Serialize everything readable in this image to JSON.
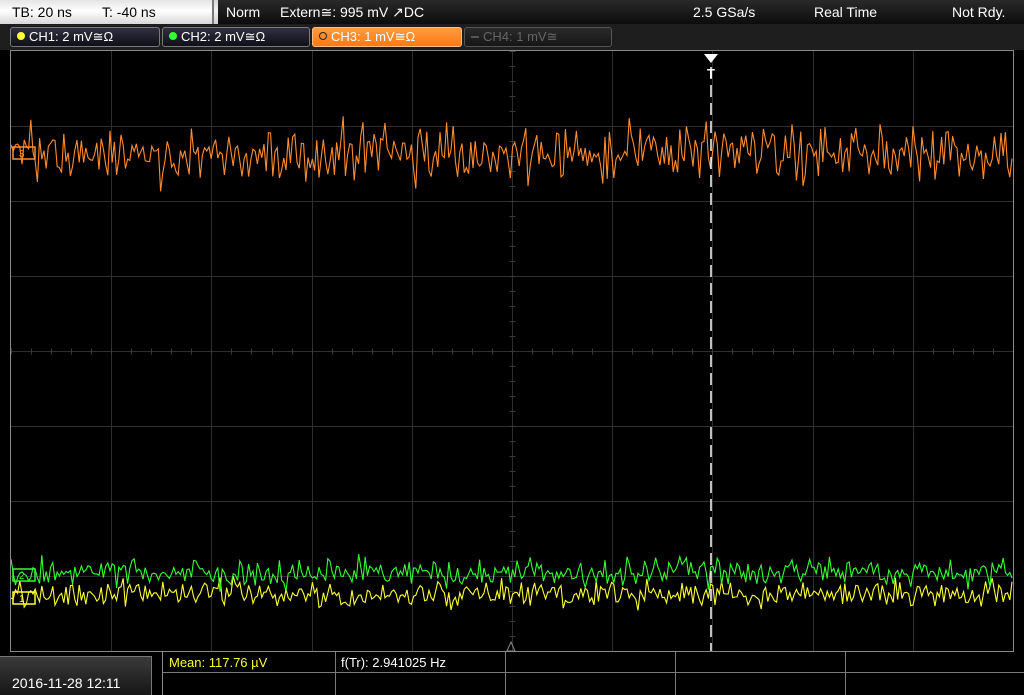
{
  "status": {
    "timebase": "TB: 20 ns",
    "trigger_time": "T: -40 ns",
    "trigger_mode": "Norm",
    "trigger_source": "Extern≅: 995 mV ↗DC",
    "sample_rate": "2.5 GSa/s",
    "acq_mode": "Real Time",
    "trigger_status": "Not Rdy."
  },
  "channels": [
    {
      "label": "CH1: 2 mV≅Ω",
      "color": "#ffff33",
      "state": "on"
    },
    {
      "label": "CH2: 2 mV≅Ω",
      "color": "#33ff33",
      "state": "on"
    },
    {
      "label": "CH3: 1 mV≅Ω",
      "color": "#ff8c2e",
      "state": "selected"
    },
    {
      "label": "CH4: 1 mV≅",
      "color": "#666666",
      "state": "off"
    }
  ],
  "trigger_marker": "T",
  "channel_markers": {
    "ch3": "3",
    "ch2": "2",
    "ch1": "1"
  },
  "footer": {
    "datetime": "2016-11-28 12:11",
    "measurements": [
      {
        "label": "Mean: 117.76 µV",
        "color": "#ffff33"
      },
      {
        "label": "f(Tr): 2.941025 Hz",
        "color": "#ffffff"
      }
    ]
  },
  "waveforms": {
    "ch3": {
      "color": "#ff8c2e",
      "level": 0.17,
      "amplitude": 0.045
    },
    "ch2": {
      "color": "#33ff33",
      "level": 0.87,
      "amplitude": 0.022
    },
    "ch1": {
      "color": "#ffff33",
      "level": 0.905,
      "amplitude": 0.02
    }
  }
}
